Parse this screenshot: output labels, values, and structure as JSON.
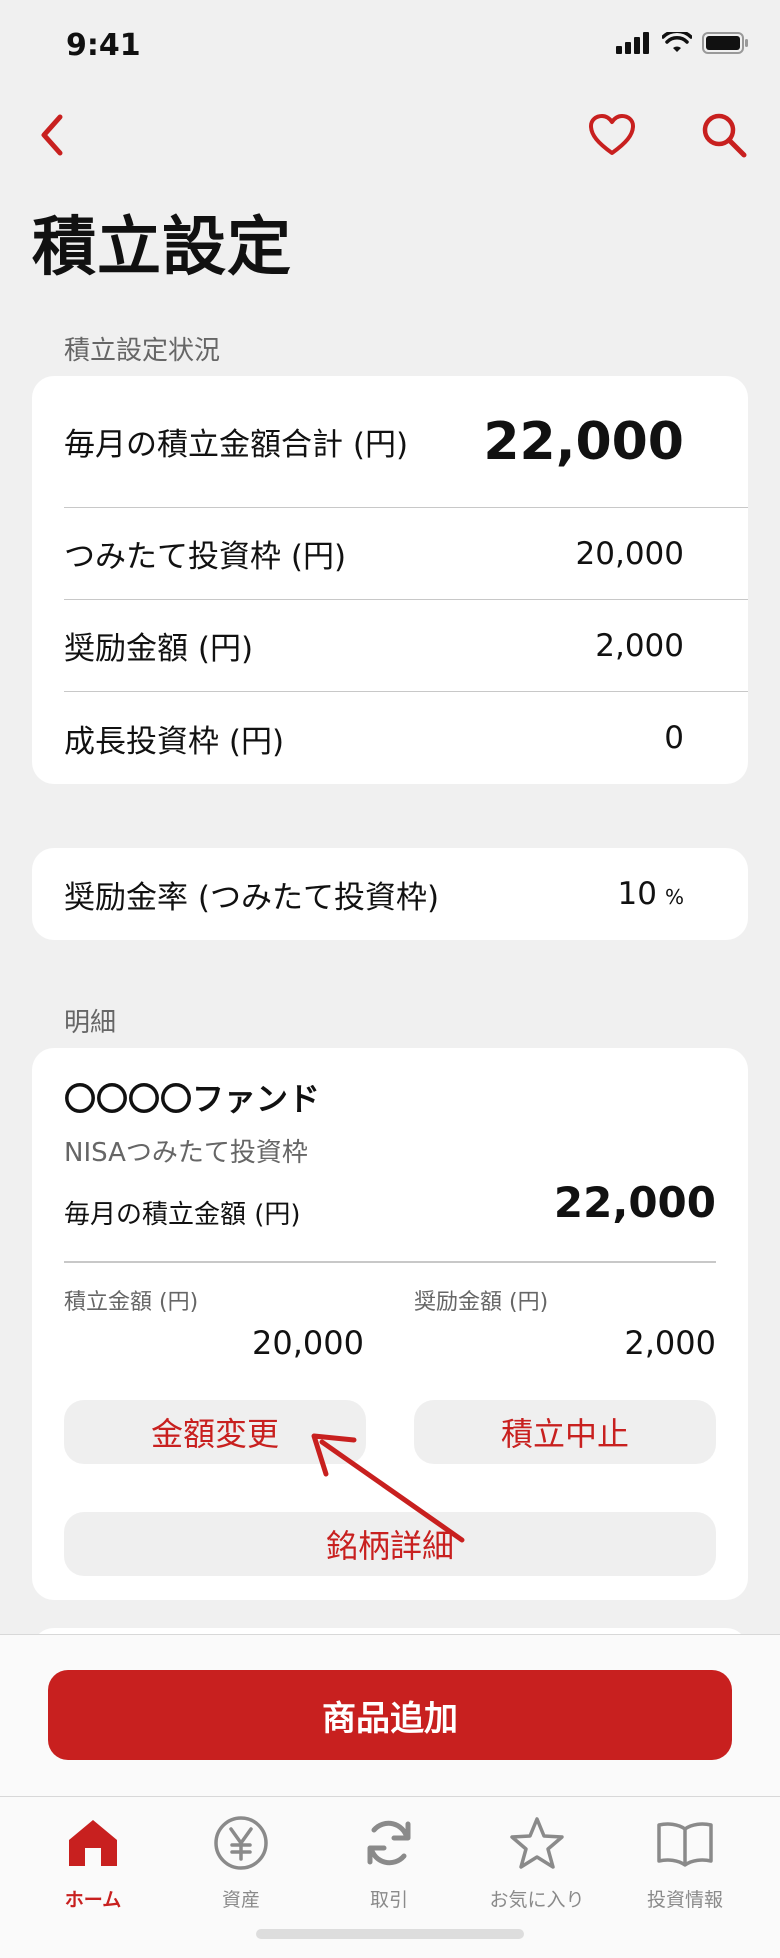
{
  "status": {
    "time": "9:41"
  },
  "header": {
    "title": "積立設定"
  },
  "summary": {
    "section_label": "積立設定状況",
    "total_label": "毎月の積立金額合計 (円)",
    "total_value": "22,000",
    "rows": [
      {
        "label": "つみたて投資枠 (円)",
        "value": "20,000"
      },
      {
        "label": "奨励金額 (円)",
        "value": "2,000"
      },
      {
        "label": "成長投資枠 (円)",
        "value": "0"
      }
    ]
  },
  "rate": {
    "label": "奨励金率 (つみたて投資枠)",
    "value": "10",
    "unit": "%"
  },
  "detail": {
    "section_label": "明細",
    "fund": {
      "name": "〇〇〇〇ファンド",
      "account_type": "NISAつみたて投資枠",
      "monthly_label": "毎月の積立金額 (円)",
      "monthly_value": "22,000",
      "contrib_label": "積立金額 (円)",
      "contrib_value": "20,000",
      "incentive_label": "奨励金額 (円)",
      "incentive_value": "2,000",
      "change_button": "金額変更",
      "stop_button": "積立中止",
      "detail_button": "銘柄詳細"
    }
  },
  "primary_button": "商品追加",
  "tabs": [
    {
      "label": "ホーム",
      "icon": "home-icon",
      "active": true
    },
    {
      "label": "資産",
      "icon": "yen-icon"
    },
    {
      "label": "取引",
      "icon": "refresh-icon"
    },
    {
      "label": "お気に入り",
      "icon": "star-icon"
    },
    {
      "label": "投資情報",
      "icon": "book-icon"
    }
  ],
  "colors": {
    "accent": "#c8201f",
    "background": "#f0f0f0",
    "card": "#ffffff"
  }
}
